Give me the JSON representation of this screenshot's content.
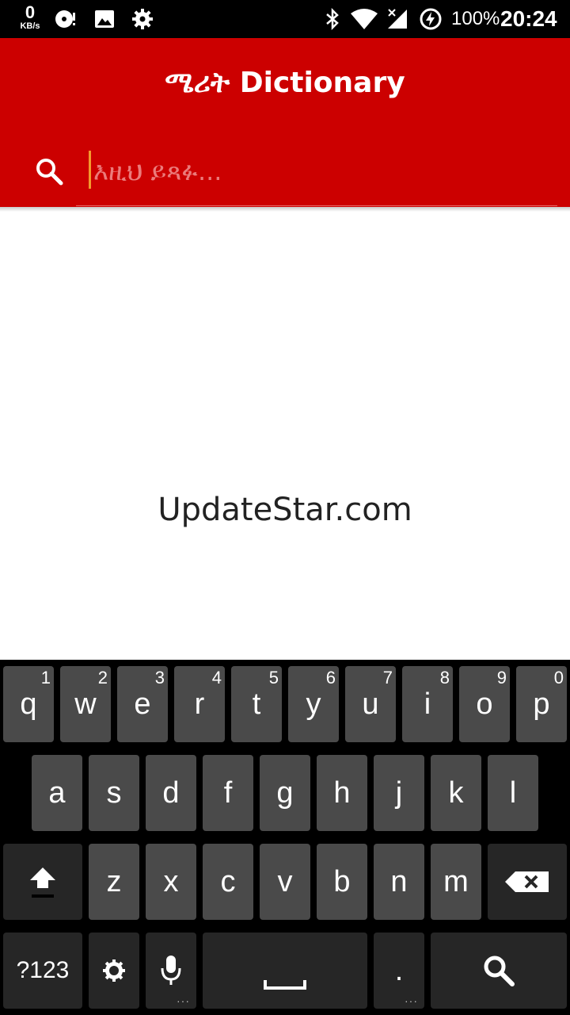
{
  "status_bar": {
    "net_speed_value": "0",
    "net_speed_unit": "KB/s",
    "battery_percent": "100%",
    "time": "20:24"
  },
  "app_bar": {
    "title": "ሜሪት Dictionary",
    "search_placeholder": "እዚህ ይጻፉ...",
    "search_value": ""
  },
  "watermark": "UpdateStar.com",
  "keyboard": {
    "row1": [
      {
        "label": "q",
        "hint": "1"
      },
      {
        "label": "w",
        "hint": "2"
      },
      {
        "label": "e",
        "hint": "3"
      },
      {
        "label": "r",
        "hint": "4"
      },
      {
        "label": "t",
        "hint": "5"
      },
      {
        "label": "y",
        "hint": "6"
      },
      {
        "label": "u",
        "hint": "7"
      },
      {
        "label": "i",
        "hint": "8"
      },
      {
        "label": "o",
        "hint": "9"
      },
      {
        "label": "p",
        "hint": "0"
      }
    ],
    "row2": [
      "a",
      "s",
      "d",
      "f",
      "g",
      "h",
      "j",
      "k",
      "l"
    ],
    "row3": [
      "z",
      "x",
      "c",
      "v",
      "b",
      "n",
      "m"
    ],
    "symbols_label": "?123",
    "period_label": ".",
    "icons": {
      "shift": "shift-icon",
      "backspace": "backspace-icon",
      "settings": "settings-icon",
      "mic": "mic-icon",
      "space": "space-icon",
      "search": "search-icon"
    }
  },
  "colors": {
    "app_bar": "#cc0000",
    "cursor": "#f29a2e",
    "key": "#4a4a4a",
    "key_dark": "#262626"
  }
}
